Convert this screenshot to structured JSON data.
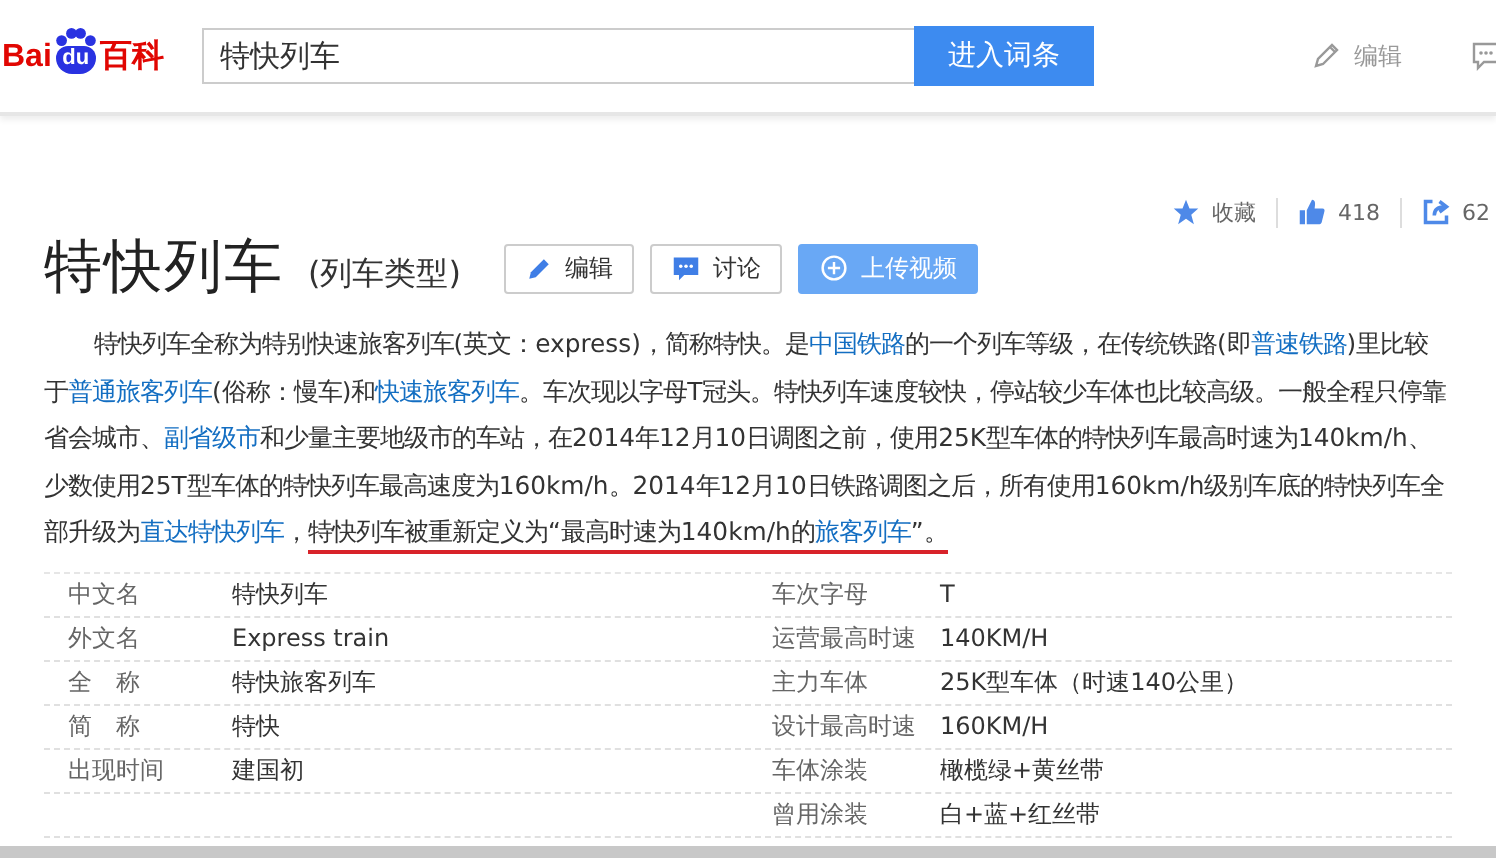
{
  "header": {
    "logo": {
      "left": "Bai",
      "middle": "du",
      "right": "百科"
    },
    "search": {
      "value": "特快列车"
    },
    "search_button": "进入词条",
    "edit_link": "编辑"
  },
  "stats": [
    {
      "kind": "star",
      "label": "收藏"
    },
    {
      "kind": "like",
      "label": "418"
    },
    {
      "kind": "share",
      "label": "62"
    }
  ],
  "title": "特快列车",
  "subtitle": "(列车类型)",
  "actions": [
    {
      "kind": "edit",
      "label": "编辑",
      "primary": false
    },
    {
      "kind": "discuss",
      "label": "讨论",
      "primary": false
    },
    {
      "kind": "upload",
      "label": "上传视频",
      "primary": true
    }
  ],
  "paragraph": [
    {
      "text": "特快列车全称为特别快速旅客列车(英文：express)，简称特快。是",
      "link": false,
      "underlined": false
    },
    {
      "text": "中国铁路",
      "link": true,
      "underlined": false
    },
    {
      "text": "的一个列车等级，在传统铁路(即",
      "link": false,
      "underlined": false
    },
    {
      "text": "普速铁路",
      "link": true,
      "underlined": false
    },
    {
      "text": ")里比较于",
      "link": false,
      "underlined": false
    },
    {
      "text": "普通旅客列车",
      "link": true,
      "underlined": false
    },
    {
      "text": "(俗称：慢车)和",
      "link": false,
      "underlined": false
    },
    {
      "text": "快速旅客列车",
      "link": true,
      "underlined": false
    },
    {
      "text": "。车次现以字母T冠头。特快列车速度较快，停站较少车体也比较高级。一般全程只停靠省会城市、",
      "link": false,
      "underlined": false
    },
    {
      "text": "副省级市",
      "link": true,
      "underlined": false
    },
    {
      "text": "和少量主要地级市的车站，在2014年12月10日调图之前，使用25K型车体的特快列车最高时速为140km/h、少数使用25T型车体的特快列车最高速度为160km/h。2014年12月10日铁路调图之后，所有使用160km/h级别车底的特快列车全部升级为",
      "link": false,
      "underlined": false
    },
    {
      "text": "直达特快列车",
      "link": true,
      "underlined": false
    },
    {
      "text": "，",
      "link": false,
      "underlined": false
    },
    {
      "text": "特快列车被重新定义为“最高时速为140km/h的",
      "link": false,
      "underlined": true
    },
    {
      "text": "旅客列车",
      "link": true,
      "underlined": true
    },
    {
      "text": "”。",
      "link": false,
      "underlined": true
    }
  ],
  "infobox": {
    "left": [
      {
        "label": "中文名",
        "value": "特快列车"
      },
      {
        "label": "外文名",
        "value": "Express train"
      },
      {
        "label": "全　称",
        "value": "特快旅客列车"
      },
      {
        "label": "简　称",
        "value": "特快"
      },
      {
        "label": "出现时间",
        "value": "建国初"
      }
    ],
    "right": [
      {
        "label": "车次字母",
        "value": "T"
      },
      {
        "label": "运营最高时速",
        "value": "140KM/H"
      },
      {
        "label": "主力车体",
        "value": "25K型车体（时速140公里）"
      },
      {
        "label": "设计最高时速",
        "value": "160KM/H"
      },
      {
        "label": "车体涂装",
        "value": "橄榄绿+黄丝带"
      },
      {
        "label": "曾用涂装",
        "value": "白+蓝+红丝带"
      }
    ]
  }
}
